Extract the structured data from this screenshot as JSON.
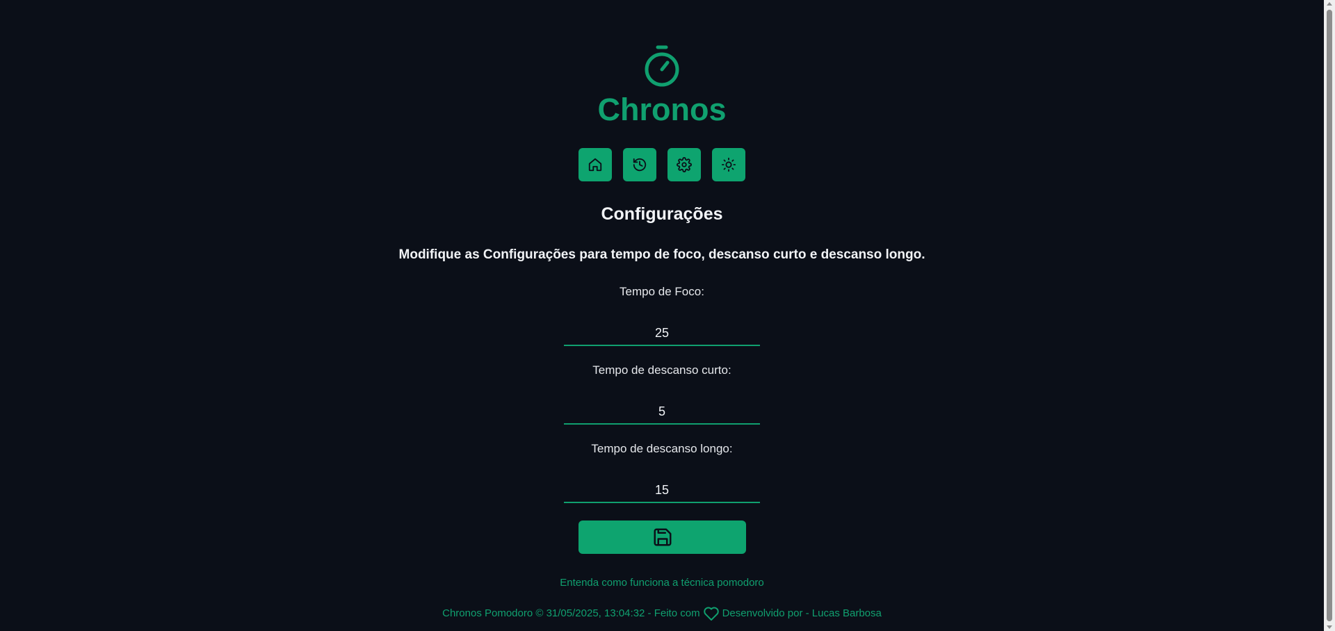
{
  "app": {
    "title": "Chronos",
    "accent_color": "#10a06f",
    "background_color": "#0b0f18",
    "logo_icon": "stopwatch-icon"
  },
  "nav": {
    "items": [
      {
        "icon": "home-icon"
      },
      {
        "icon": "history-icon"
      },
      {
        "icon": "gear-icon"
      },
      {
        "icon": "sun-icon"
      }
    ]
  },
  "settings": {
    "title": "Configurações",
    "description": "Modifique as Configurações para tempo de foco, descanso curto e descanso longo.",
    "fields": [
      {
        "label": "Tempo de Foco:",
        "value": "25"
      },
      {
        "label": "Tempo de descanso curto:",
        "value": "5"
      },
      {
        "label": "Tempo de descanso longo:",
        "value": "15"
      }
    ],
    "save_icon": "floppy-disk-icon"
  },
  "links": {
    "learn": "Entenda como funciona a técnica pomodoro"
  },
  "footer": {
    "text_before": "Chronos Pomodoro © 31/05/2025, 13:04:32 - Feito com",
    "heart_icon": "heart-icon",
    "text_after": "Desenvolvido por - Lucas Barbosa"
  }
}
